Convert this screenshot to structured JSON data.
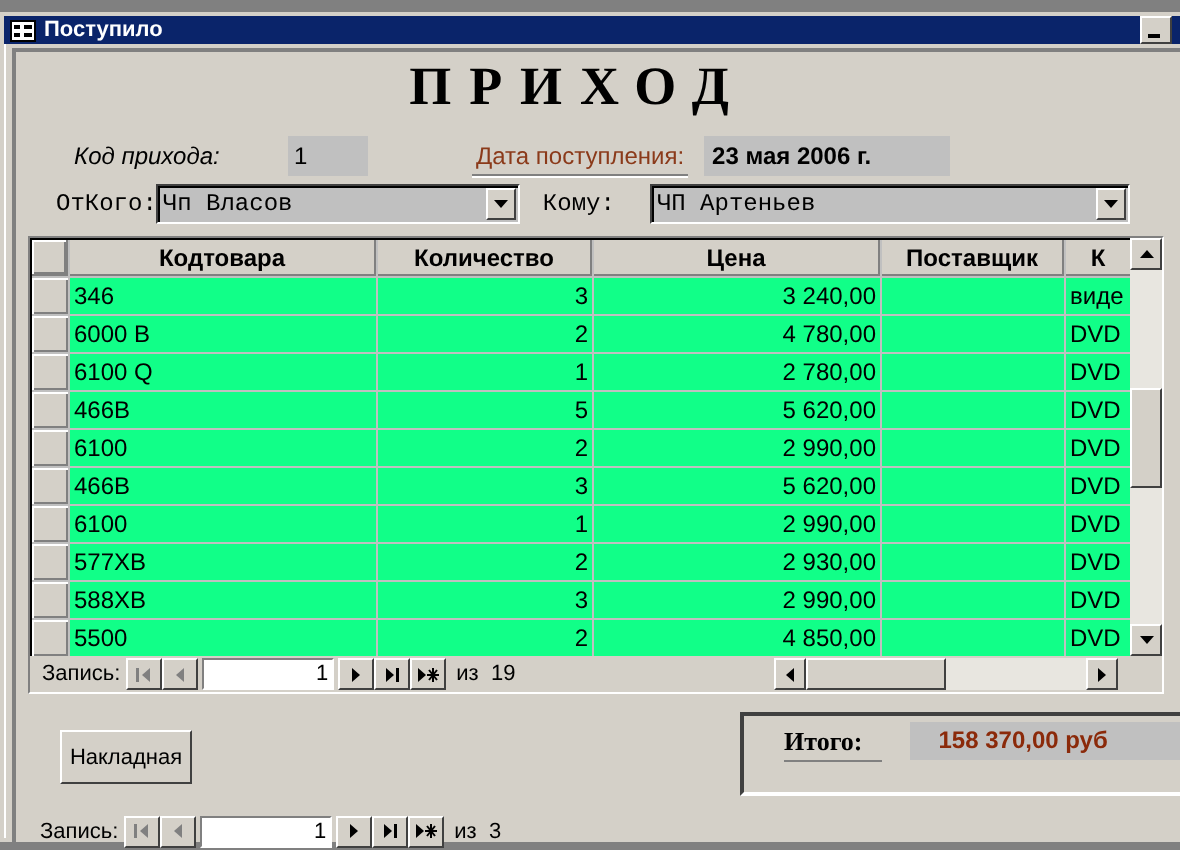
{
  "window": {
    "title": "Поступило"
  },
  "heading": "ПРИХОД",
  "fields": {
    "code_label": "Код прихода:",
    "code_value": "1",
    "date_label": "Дата поступления:",
    "date_value": "23 мая 2006 г.",
    "from_label": "ОтКого:",
    "from_value": "Чп Власов",
    "to_label": "Кому:",
    "to_value": "ЧП Артеньев"
  },
  "table": {
    "columns": [
      "Кодтовара",
      "Количество",
      "Цена",
      "Поставщик",
      "К"
    ],
    "rows": [
      {
        "cells": [
          "346",
          "3",
          "3 240,00",
          "",
          "виде"
        ]
      },
      {
        "cells": [
          "6000 B",
          "2",
          "4 780,00",
          "",
          "DVD"
        ]
      },
      {
        "cells": [
          "6100 Q",
          "1",
          "2 780,00",
          "",
          "DVD"
        ]
      },
      {
        "cells": [
          "466B",
          "5",
          "5 620,00",
          "",
          "DVD"
        ]
      },
      {
        "cells": [
          "6100",
          "2",
          "2 990,00",
          "",
          "DVD"
        ]
      },
      {
        "cells": [
          "466B",
          "3",
          "5 620,00",
          "",
          "DVD"
        ]
      },
      {
        "cells": [
          "6100",
          "1",
          "2 990,00",
          "",
          "DVD"
        ]
      },
      {
        "cells": [
          "577XB",
          "2",
          "2 930,00",
          "",
          "DVD"
        ]
      },
      {
        "cells": [
          "588XB",
          "3",
          "2 990,00",
          "",
          "DVD"
        ]
      },
      {
        "cells": [
          "5500",
          "2",
          "4 850,00",
          "",
          "DVD"
        ]
      }
    ],
    "navigator": {
      "label": "Запись:",
      "value": "1",
      "of": "из  19",
      "buttons": [
        {
          "kind": "first",
          "disabled": true
        },
        {
          "kind": "prev",
          "disabled": true
        },
        {
          "kind": "next",
          "disabled": false
        },
        {
          "kind": "last",
          "disabled": false
        },
        {
          "kind": "new",
          "disabled": false
        }
      ]
    }
  },
  "invoice_button": "Накладная",
  "total": {
    "label": "Итого:",
    "value": "158 370,00 руб"
  },
  "navigator": {
    "label": "Запись:",
    "value": "1",
    "of": "из  3",
    "buttons": [
      {
        "kind": "first",
        "disabled": true
      },
      {
        "kind": "prev",
        "disabled": true
      },
      {
        "kind": "next",
        "disabled": false
      },
      {
        "kind": "last",
        "disabled": false
      },
      {
        "kind": "new",
        "disabled": false
      }
    ]
  }
}
